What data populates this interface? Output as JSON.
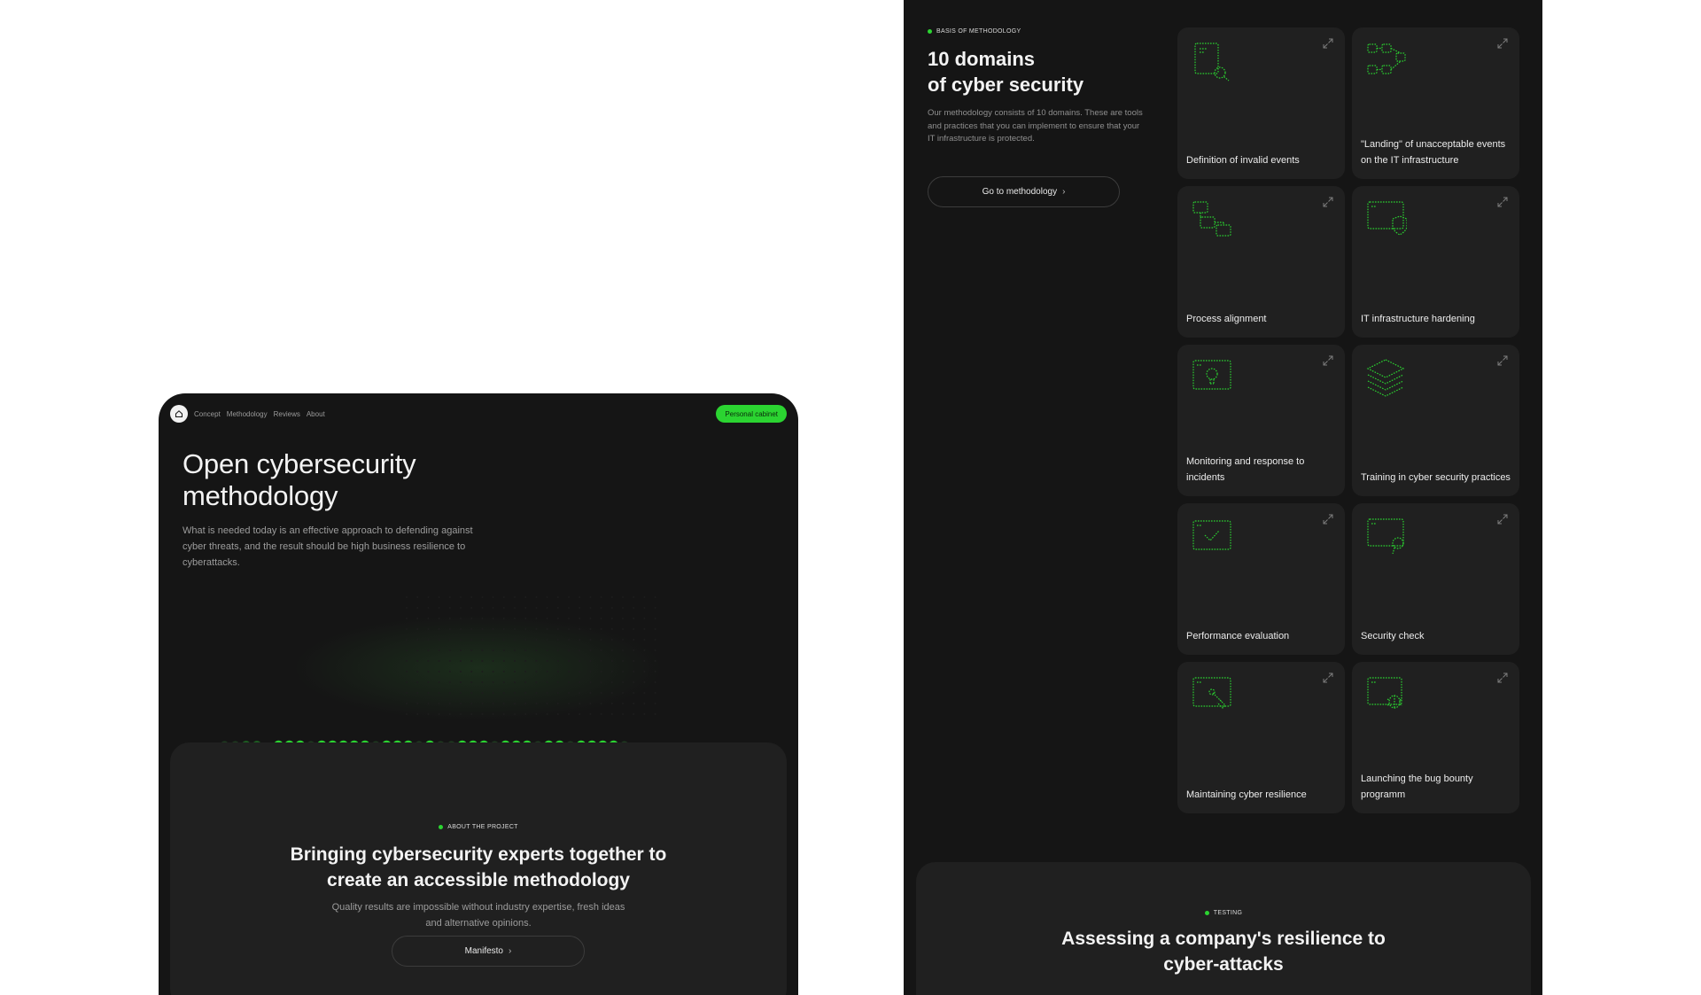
{
  "nav": {
    "links": [
      "Concept",
      "Methodology",
      "Reviews",
      "About"
    ],
    "cabinet_label": "Personal cabinet"
  },
  "hero": {
    "title": "Open cybersecurity methodology",
    "description": "What is needed today is an effective approach to defending against cyber threats, and the result should be high business resilience to cyberattacks."
  },
  "about": {
    "eyebrow": "ABOUT THE PROJECT",
    "title": "Bringing cybersecurity experts together to create an accessible methodology",
    "description": "Quality results are impossible without industry expertise, fresh ideas and alternative opinions.",
    "button": "Manifesto"
  },
  "methodology": {
    "eyebrow": "BASIS OF METHODOLOGY",
    "title_line1": "10 domains",
    "title_line2": "of cyber security",
    "description": "Our methodology consists of 10 domains. These are tools and practices that you can implement to ensure that your IT infrastructure is protected.",
    "button": "Go to methodology",
    "domains": [
      {
        "label": "Definition of invalid events",
        "icon": "document-search-icon"
      },
      {
        "label": "\"Landing\" of unacceptable events on the IT infrastructure",
        "icon": "network-nodes-icon"
      },
      {
        "label": "Process alignment",
        "icon": "process-flow-icon"
      },
      {
        "label": "IT infrastructure hardening",
        "icon": "window-shield-icon"
      },
      {
        "label": "Monitoring and response to incidents",
        "icon": "window-lightbulb-icon"
      },
      {
        "label": "Training in cyber security practices",
        "icon": "layers-icon"
      },
      {
        "label": "Performance evaluation",
        "icon": "window-check-icon"
      },
      {
        "label": "Security check",
        "icon": "window-magnifier-icon"
      },
      {
        "label": "Maintaining cyber resilience",
        "icon": "window-wrench-icon"
      },
      {
        "label": "Launching the bug bounty programm",
        "icon": "window-bug-icon"
      }
    ]
  },
  "testing": {
    "eyebrow": "TESTING",
    "title": "Assessing a company's resilience to cyber-attacks"
  },
  "colors": {
    "accent": "#2bd431",
    "background": "#151515",
    "card": "#202020"
  }
}
